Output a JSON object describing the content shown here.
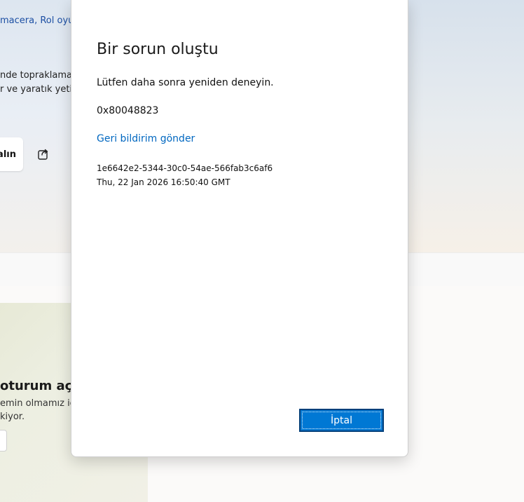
{
  "background": {
    "tags": "macera, Rol oyunla",
    "description_lines": [
      "nde topraklamada",
      "r ve yaratık yetişt"
    ],
    "action_button_label": "alın",
    "signin_title": "oturum açı",
    "signin_lines": [
      "emin olmamız için",
      "kiyor."
    ]
  },
  "dialog": {
    "title": "Bir sorun oluştu",
    "message": "Lütfen daha sonra yeniden deneyin.",
    "error_code": "0x80048823",
    "feedback_link": "Geri bildirim gönder",
    "correlation_id": "1e6642e2-5344-30c0-54ae-566fab3c6af6",
    "timestamp": "Thu, 22 Jan 2026 16:50:40 GMT",
    "cancel_label": "İptal",
    "accent_color": "#0078d4",
    "link_color": "#0067c0"
  },
  "icons": {
    "share": "share-icon"
  }
}
